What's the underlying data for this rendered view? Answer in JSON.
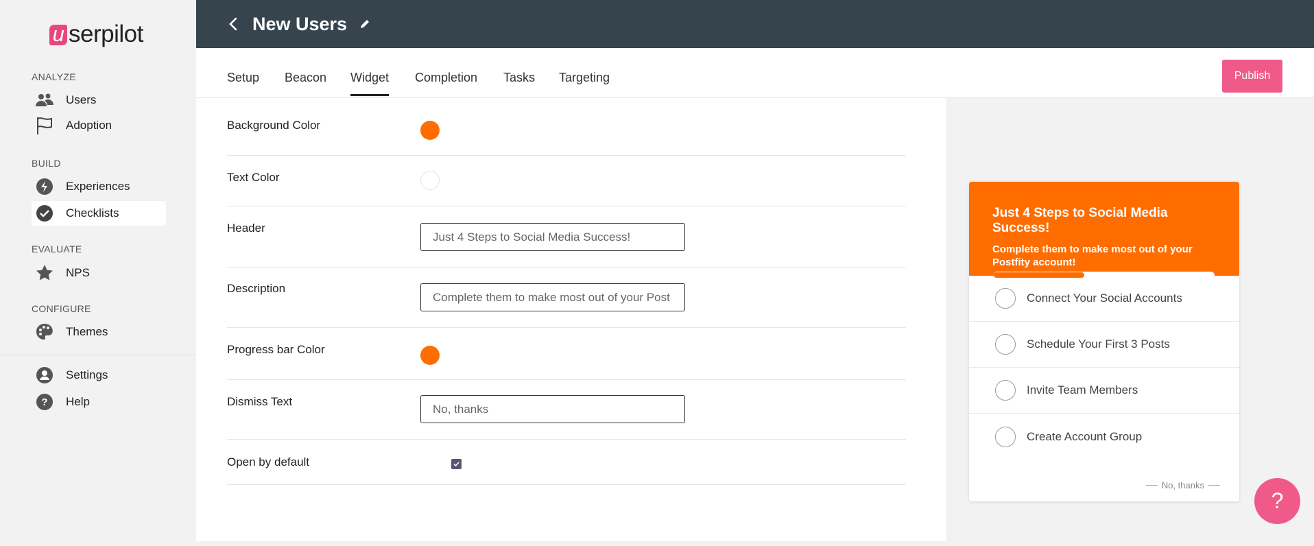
{
  "logo": {
    "mark": "u",
    "rest": "serpilot"
  },
  "sidebar": {
    "sections": [
      "ANALYZE",
      "BUILD",
      "EVALUATE",
      "CONFIGURE"
    ],
    "items": [
      {
        "label": "Users",
        "icon": "users-icon"
      },
      {
        "label": "Adoption",
        "icon": "flag-icon"
      },
      {
        "label": "Experiences",
        "icon": "lightning-icon"
      },
      {
        "label": "Checklists",
        "icon": "check-circle-icon",
        "active": true
      },
      {
        "label": "NPS",
        "icon": "star-icon"
      },
      {
        "label": "Themes",
        "icon": "palette-icon"
      },
      {
        "label": "Settings",
        "icon": "person-icon"
      },
      {
        "label": "Help",
        "icon": "question-icon"
      }
    ]
  },
  "header": {
    "title": "New Users"
  },
  "tabs": [
    {
      "label": "Setup"
    },
    {
      "label": "Beacon"
    },
    {
      "label": "Widget",
      "active": true
    },
    {
      "label": "Completion"
    },
    {
      "label": "Tasks"
    },
    {
      "label": "Targeting"
    }
  ],
  "publish_label": "Publish",
  "form": {
    "background_color": {
      "label": "Background Color",
      "value": "#ff6d00"
    },
    "text_color": {
      "label": "Text Color",
      "value": "#ffffff"
    },
    "header": {
      "label": "Header",
      "value": "Just 4 Steps to Social Media Success!"
    },
    "description": {
      "label": "Description",
      "value": "Complete them to make most out of your Post"
    },
    "progress_color": {
      "label": "Progress bar Color",
      "value": "#ff6d00"
    },
    "dismiss": {
      "label": "Dismiss Text",
      "value": "No, thanks"
    },
    "open_default": {
      "label": "Open by default",
      "checked": true
    }
  },
  "preview": {
    "title": "Just 4 Steps to Social Media Success!",
    "description": "Complete them to make most out of your Postfity account!",
    "progress": 0.41,
    "tasks": [
      "Connect Your Social Accounts",
      "Schedule Your First 3 Posts",
      "Invite Team Members",
      "Create Account Group"
    ],
    "dismiss": "No, thanks"
  },
  "help_fab": "?",
  "colors": {
    "accent": "#f05a8a",
    "brand": "#e8467c",
    "topbar": "#35444d",
    "orange": "#ff6d00"
  }
}
